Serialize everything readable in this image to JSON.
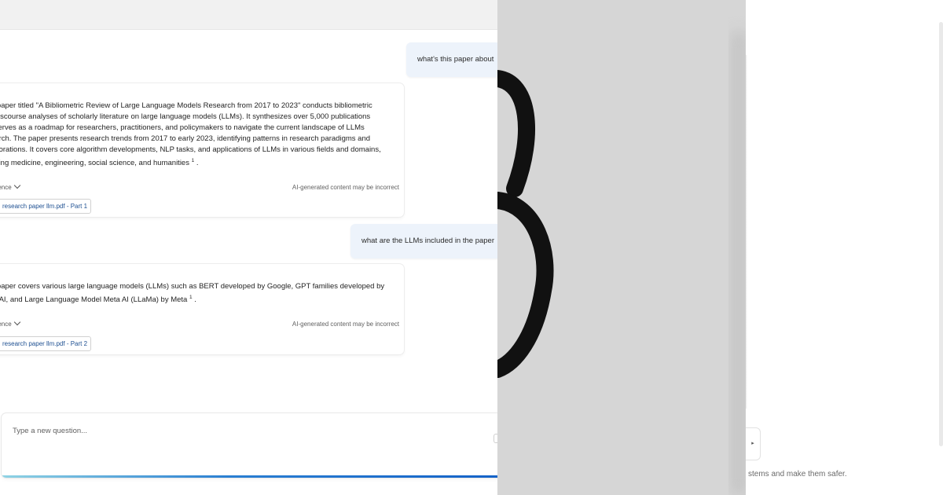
{
  "chat": {
    "messages": [
      {
        "role": "user",
        "text": "what's this paper about"
      },
      {
        "role": "assistant",
        "lines": [
          "e paper titled \"A Bibliometric Review of Large Language Models Research from 2017 to 2023\" conducts bibliometric",
          "l discourse analyses of scholarly literature on large language models (LLMs). It synthesizes over 5,000 publications",
          "l serves as a roadmap for researchers, practitioners, and policymakers to navigate the current landscape of LLMs",
          "earch. The paper presents research trends from 2017 to early 2023, identifying patterns in research paradigms and",
          "aborations. It covers core algorithm developments, NLP tasks, and applications of LLMs in various fields and domains,",
          "uding medicine, engineering, social science, and humanities"
        ],
        "citation_mark": "1",
        "trailing": " .",
        "reference_label": "ference",
        "disclaimer": "AI-generated content may be incorrect",
        "citation": "research paper llm.pdf - Part 1"
      },
      {
        "role": "user",
        "text": "what are the LLMs included in the paper"
      },
      {
        "role": "assistant",
        "lines": [
          "e paper covers various large language models (LLMs) such as BERT developed by Google, GPT families developed by",
          "enAI, and Large Language Model Meta AI (LLaMa) by Meta"
        ],
        "citation_mark": "1",
        "trailing": " .",
        "reference_label": "ference",
        "disclaimer": "AI-generated content may be incorrect",
        "citation": "research paper llm.pdf - Part 2"
      }
    ],
    "composer": {
      "placeholder": "Type a new question..."
    }
  },
  "logo": {
    "icon": "infinity-ring-logo",
    "color": "#111111",
    "background": "#d6d6d6"
  },
  "right_panel": {
    "collapse_icon": "caret-right-icon",
    "collapse_glyph": "▸",
    "caption": "stems and make them safer."
  },
  "colors": {
    "accent": "#1462c8",
    "user_bubble": "#edf3fb",
    "link": "#1d4f91"
  }
}
